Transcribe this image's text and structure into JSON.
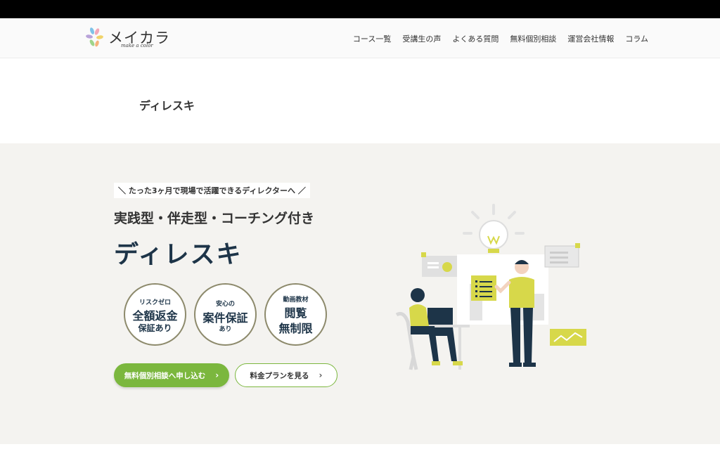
{
  "header": {
    "logo_text": "メイカラ",
    "logo_sub": "make a color",
    "nav": [
      {
        "label": "コース一覧"
      },
      {
        "label": "受講生の声"
      },
      {
        "label": "よくある質問"
      },
      {
        "label": "無料個別相談"
      },
      {
        "label": "運営会社情報"
      },
      {
        "label": "コラム"
      }
    ]
  },
  "page": {
    "title": "ディレスキ"
  },
  "hero": {
    "catch": "＼ たった3ヶ月で現場で活躍できるディレクターへ ／",
    "sub_heading": "実践型・伴走型・コーチング付き",
    "heading": "ディレスキ",
    "badges": [
      {
        "top": "リスクゼロ",
        "main": "全額返金",
        "bottom": "保証あり"
      },
      {
        "top": "安心の",
        "main": "案件保証",
        "bottom": "あり"
      },
      {
        "top": "動画教材",
        "main": "閲覧",
        "bottom": "無制限"
      }
    ],
    "primary_button": "無料個別相談へ申し込む",
    "secondary_button": "料金プランを見る"
  },
  "colors": {
    "accent_green": "#7bb73e",
    "navy": "#1d3448",
    "illustration_yellow": "#d7d84a",
    "hero_background": "#f4f3f0"
  }
}
